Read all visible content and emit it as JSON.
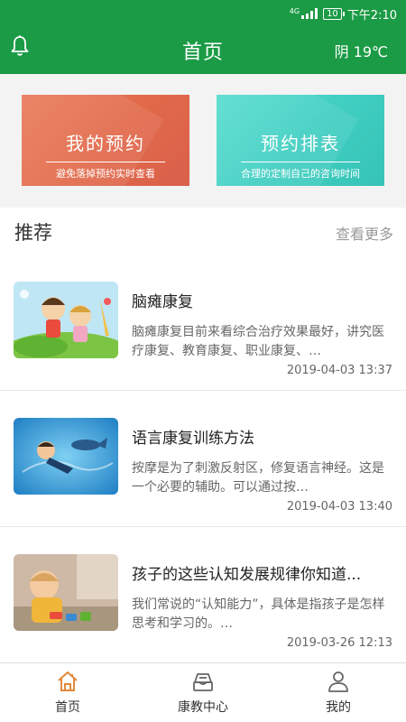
{
  "status_bar": {
    "network": "4G",
    "battery": "10",
    "time": "下午2:10"
  },
  "header": {
    "title": "首页",
    "weather": "阴 19℃",
    "icon": "bell-icon"
  },
  "cards": [
    {
      "title": "我的预约",
      "subtitle": "避免落掉预约实时查看",
      "color": "#e26a4a"
    },
    {
      "title": "预约排表",
      "subtitle": "合理的定制自己的咨询时间",
      "color": "#41cfc2"
    }
  ],
  "recommend": {
    "title": "推荐",
    "more": "查看更多"
  },
  "articles": [
    {
      "title": "脑瘫康复",
      "desc": "脑瘫康复目前来看综合治疗效果最好，讲究医疗康复、教育康复、职业康复、…",
      "date": "2019-04-03 13:37"
    },
    {
      "title": "语言康复训练方法",
      "desc": "按摩是为了刺激反射区，修复语言神经。这是一个必要的辅助。可以通过按…",
      "date": "2019-04-03 13:40"
    },
    {
      "title": "孩子的这些认知发展规律你知道...",
      "desc": "我们常说的“认知能力”，具体是指孩子是怎样思考和学习的。…",
      "date": "2019-03-26 12:13"
    }
  ],
  "tabbar": [
    {
      "label": "首页",
      "icon": "home-icon",
      "active": true,
      "active_color": "#e2893a"
    },
    {
      "label": "康教中心",
      "icon": "inbox-icon",
      "active": false
    },
    {
      "label": "我的",
      "icon": "user-icon",
      "active": false
    }
  ],
  "colors": {
    "brand_green": "#1b9b45",
    "tab_active": "#e2893a"
  }
}
